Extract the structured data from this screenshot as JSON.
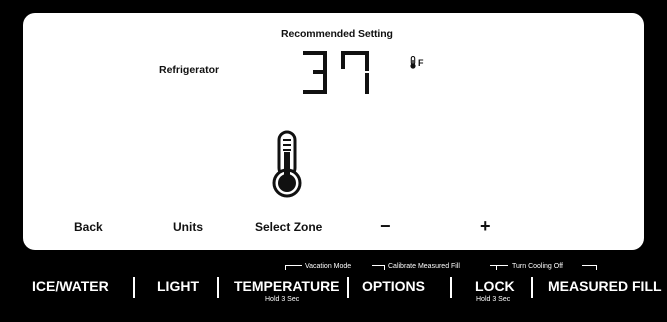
{
  "display": {
    "recommended_label": "Recommended Setting",
    "zone_label": "Refrigerator",
    "temperature_value": "37",
    "temperature_unit": "F"
  },
  "screen_buttons": {
    "back": "Back",
    "units": "Units",
    "select_zone": "Select Zone",
    "minus": "−",
    "plus": "+"
  },
  "hold_functions": {
    "vacation_mode": "Vacation Mode",
    "calibrate_measured_fill": "Calibrate Measured Fill",
    "turn_cooling_off": "Turn Cooling Off"
  },
  "bottom_buttons": {
    "ice_water": "ICE/WATER",
    "light": "LIGHT",
    "temperature": "TEMPERATURE",
    "temperature_sub": "Hold 3 Sec",
    "options": "OPTIONS",
    "lock": "LOCK",
    "lock_sub": "Hold 3 Sec",
    "measured_fill": "MEASURED FILL"
  },
  "icons": {
    "unit_icon": "thermometer-icon",
    "zone_icon": "thermometer-icon"
  },
  "colors": {
    "panel_background": "#000000",
    "screen_background": "#ffffff",
    "text_dark": "#111111",
    "text_light": "#ffffff"
  }
}
